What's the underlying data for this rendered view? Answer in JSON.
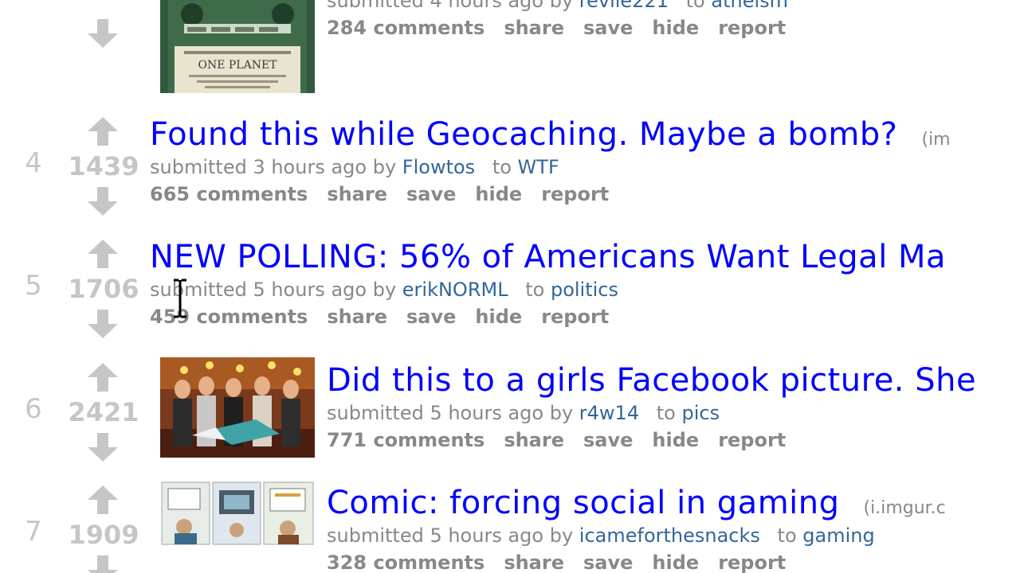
{
  "colors": {
    "title_link": "#0000ff",
    "meta_link": "#336699",
    "muted": "#888888",
    "score": "#c6c6c6",
    "arrow": "#c6c6c6"
  },
  "icons": {
    "upvote": "upvote-arrow-icon",
    "downvote": "downvote-arrow-icon",
    "cursor": "text-cursor-icon"
  },
  "posts": [
    {
      "rank": "",
      "score": "",
      "title": "",
      "domain": "",
      "time": "submitted 4 hours ago by",
      "author": "revlle221",
      "to": "to",
      "subreddit": "atheism",
      "comments": "284 comments",
      "share": "share",
      "save": "save",
      "hide": "hide",
      "report": "report",
      "thumb_caption": "ONE PLANET"
    },
    {
      "rank": "4",
      "score": "1439",
      "title": "Found this while Geocaching. Maybe a bomb?",
      "domain": "(im",
      "time": "submitted 3 hours ago by",
      "author": "Flowtos",
      "to": "to",
      "subreddit": "WTF",
      "comments": "665 comments",
      "share": "share",
      "save": "save",
      "hide": "hide",
      "report": "report"
    },
    {
      "rank": "5",
      "score": "1706",
      "title": "NEW POLLING: 56% of Americans Want Legal Ma",
      "domain": "",
      "time": "submitted 5 hours ago by",
      "author": "erikNORML",
      "to": "to",
      "subreddit": "politics",
      "comments": "459 comments",
      "share": "share",
      "save": "save",
      "hide": "hide",
      "report": "report"
    },
    {
      "rank": "6",
      "score": "2421",
      "title": "Did this to a girls Facebook picture. She",
      "domain": "",
      "time": "submitted 5 hours ago by",
      "author": "r4w14",
      "to": "to",
      "subreddit": "pics",
      "comments": "771 comments",
      "share": "share",
      "save": "save",
      "hide": "hide",
      "report": "report"
    },
    {
      "rank": "7",
      "score": "1909",
      "title": "Comic: forcing social in gaming",
      "domain": "(i.imgur.c",
      "time": "submitted 5 hours ago by",
      "author": "icameforthesnacks",
      "to": "to",
      "subreddit": "gaming",
      "comments": "328 comments",
      "share": "share",
      "save": "save",
      "hide": "hide",
      "report": "report"
    }
  ]
}
